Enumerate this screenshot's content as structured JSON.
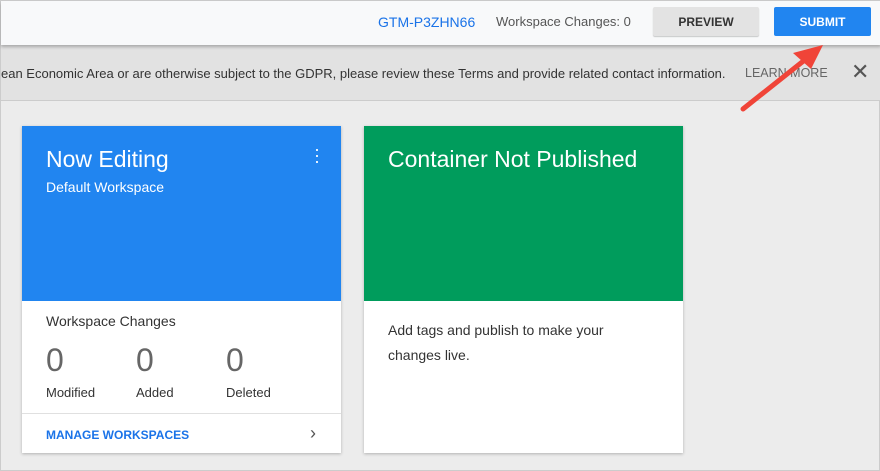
{
  "header": {
    "container_id": "GTM-P3ZHN66",
    "workspace_changes": "Workspace Changes: 0",
    "preview_label": "PREVIEW",
    "submit_label": "SUBMIT"
  },
  "banner": {
    "text": "ean Economic Area or are otherwise subject to the GDPR, please review these Terms and provide related contact information.",
    "learn_more": "LEARN MORE"
  },
  "editing_card": {
    "title": "Now Editing",
    "subtitle": "Default Workspace",
    "changes_title": "Workspace Changes",
    "stats": [
      {
        "value": "0",
        "label": "Modified"
      },
      {
        "value": "0",
        "label": "Added"
      },
      {
        "value": "0",
        "label": "Deleted"
      }
    ],
    "manage_label": "MANAGE WORKSPACES"
  },
  "publish_card": {
    "title": "Container Not Published",
    "description": "Add tags and publish to make your changes live."
  },
  "colors": {
    "accent": "#2185f0",
    "green": "#009c5c",
    "arrow": "#f04438"
  }
}
